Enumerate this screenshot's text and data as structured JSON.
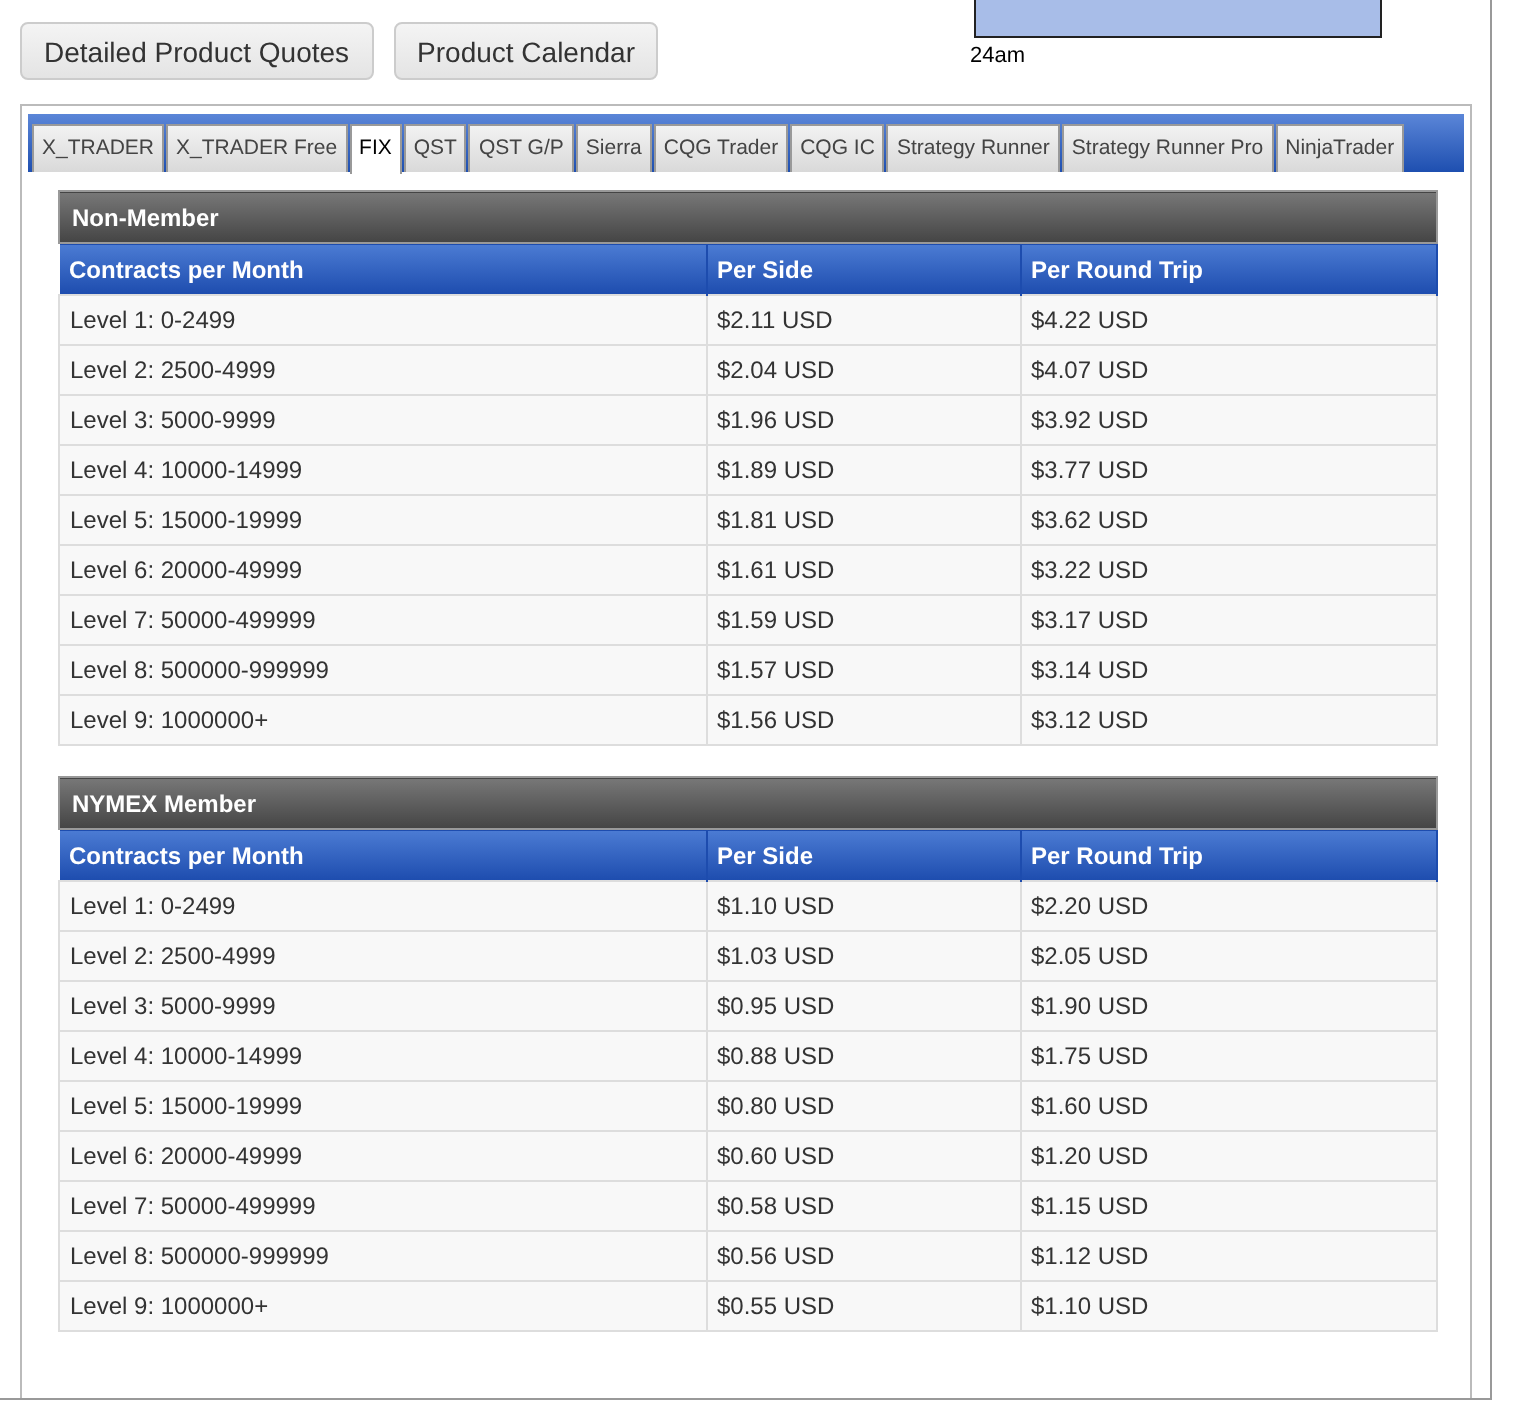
{
  "buttons": [
    "Detailed Product Quotes",
    "Product Calendar"
  ],
  "chart_fragment": {
    "axis_label": "24am"
  },
  "tabs": [
    {
      "label": "X_TRADER",
      "selected": false
    },
    {
      "label": "X_TRADER Free",
      "selected": false
    },
    {
      "label": "FIX",
      "selected": true
    },
    {
      "label": "QST",
      "selected": false
    },
    {
      "label": "QST G/P",
      "selected": false
    },
    {
      "label": "Sierra",
      "selected": false
    },
    {
      "label": "CQG Trader",
      "selected": false
    },
    {
      "label": "CQG IC",
      "selected": false
    },
    {
      "label": "Strategy Runner",
      "selected": false
    },
    {
      "label": "Strategy Runner Pro",
      "selected": false
    },
    {
      "label": "NinjaTrader",
      "selected": false
    }
  ],
  "tables": [
    {
      "title": "Non-Member",
      "columns": [
        "Contracts per Month",
        "Per Side",
        "Per Round Trip"
      ],
      "rows": [
        [
          "Level 1: 0-2499",
          "$2.11 USD",
          "$4.22 USD"
        ],
        [
          "Level 2: 2500-4999",
          "$2.04 USD",
          "$4.07 USD"
        ],
        [
          "Level 3: 5000-9999",
          "$1.96 USD",
          "$3.92 USD"
        ],
        [
          "Level 4: 10000-14999",
          "$1.89 USD",
          "$3.77 USD"
        ],
        [
          "Level 5: 15000-19999",
          "$1.81 USD",
          "$3.62 USD"
        ],
        [
          "Level 6: 20000-49999",
          "$1.61 USD",
          "$3.22 USD"
        ],
        [
          "Level 7: 50000-499999",
          "$1.59 USD",
          "$3.17 USD"
        ],
        [
          "Level 8: 500000-999999",
          "$1.57 USD",
          "$3.14 USD"
        ],
        [
          "Level 9: 1000000+",
          "$1.56 USD",
          "$3.12 USD"
        ]
      ]
    },
    {
      "title": "NYMEX Member",
      "columns": [
        "Contracts per Month",
        "Per Side",
        "Per Round Trip"
      ],
      "rows": [
        [
          "Level 1: 0-2499",
          "$1.10 USD",
          "$2.20 USD"
        ],
        [
          "Level 2: 2500-4999",
          "$1.03 USD",
          "$2.05 USD"
        ],
        [
          "Level 3: 5000-9999",
          "$0.95 USD",
          "$1.90 USD"
        ],
        [
          "Level 4: 10000-14999",
          "$0.88 USD",
          "$1.75 USD"
        ],
        [
          "Level 5: 15000-19999",
          "$0.80 USD",
          "$1.60 USD"
        ],
        [
          "Level 6: 20000-49999",
          "$0.60 USD",
          "$1.20 USD"
        ],
        [
          "Level 7: 50000-499999",
          "$0.58 USD",
          "$1.15 USD"
        ],
        [
          "Level 8: 500000-999999",
          "$0.56 USD",
          "$1.12 USD"
        ],
        [
          "Level 9: 1000000+",
          "$0.55 USD",
          "$1.10 USD"
        ]
      ]
    }
  ]
}
